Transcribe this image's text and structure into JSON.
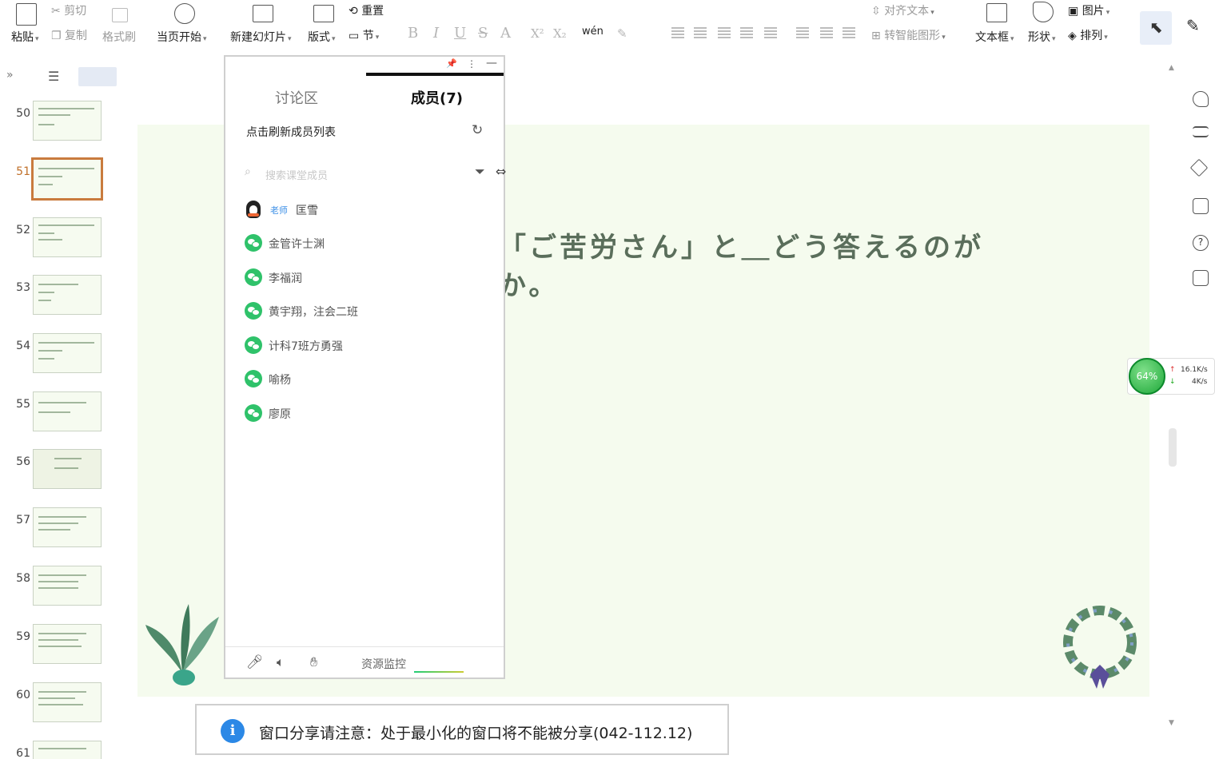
{
  "ribbon": {
    "paste": "粘贴",
    "cut": "剪切",
    "copy": "复制",
    "format_painter": "格式刷",
    "from_current": "当页开始",
    "new_slide": "新建幻灯片",
    "layout": "版式",
    "section": "节",
    "reset": "重置",
    "align_text": "对齐文本",
    "smart_graphic": "转智能图形",
    "text_box": "文本框",
    "shape": "形状",
    "arrange": "排列",
    "picture": "图片",
    "pinyin": "wén"
  },
  "sidebar": {
    "active_slide": "51",
    "slides": [
      "50",
      "51",
      "52",
      "53",
      "54",
      "55",
      "56",
      "57",
      "58",
      "59",
      "60",
      "61"
    ]
  },
  "slide": {
    "line1": "「ご苦労さん」と＿どう答えるのが",
    "line2": "か。"
  },
  "panel": {
    "tab_discussion": "讨论区",
    "tab_members": "成员(7)",
    "refresh_label": "点击刷新成员列表",
    "search_placeholder": "搜索课堂成员",
    "teacher_badge": "老师",
    "teacher_name": "匡雪",
    "members": [
      "金管许士渊",
      "李福润",
      "黄宇翔，注会二班",
      "计科7班方勇强",
      "喻杨",
      "廖原"
    ],
    "footer_monitor": "资源监控"
  },
  "network": {
    "percent": "64%",
    "up": "16.1K/s",
    "down": "4K/s"
  },
  "toast": {
    "message": "窗口分享请注意：处于最小化的窗口将不能被分享(042-112.12)"
  },
  "colors": {
    "slide_bg": "#f5fbee",
    "active_slide_border": "#c97b3e",
    "wechat_green": "#2fc26a",
    "info_blue": "#2b88e6"
  }
}
